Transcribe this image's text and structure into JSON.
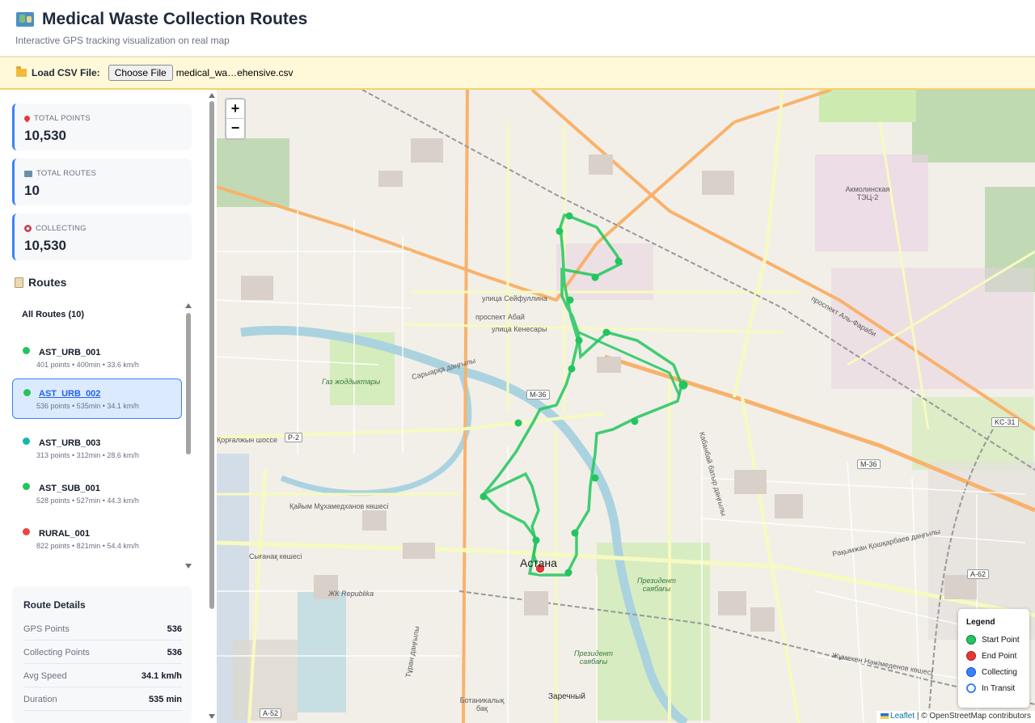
{
  "header": {
    "title": "Medical Waste Collection Routes",
    "subtitle": "Interactive GPS tracking visualization on real map"
  },
  "loader": {
    "label": "Load CSV File:",
    "button": "Choose File",
    "filename": "medical_wa…ehensive.csv"
  },
  "stats": [
    {
      "label": "TOTAL POINTS",
      "value": "10,530"
    },
    {
      "label": "TOTAL ROUTES",
      "value": "10"
    },
    {
      "label": "COLLECTING",
      "value": "10,530"
    }
  ],
  "routes": {
    "heading": "Routes",
    "all_label": "All Routes (10)",
    "items": [
      {
        "name": "AST_URB_001",
        "meta": "401 points • 400min • 33.6 km/h",
        "color": "#22c55e"
      },
      {
        "name": "AST_URB_002",
        "meta": "536 points • 535min • 34.1 km/h",
        "color": "#22c55e"
      },
      {
        "name": "AST_URB_003",
        "meta": "313 points • 312min • 28.6 km/h",
        "color": "#14b8a6"
      },
      {
        "name": "AST_SUB_001",
        "meta": "528 points • 527min • 44.3 km/h",
        "color": "#22c55e"
      },
      {
        "name": "RURAL_001",
        "meta": "822 points • 821min • 54.4 km/h",
        "color": "#ef4444"
      }
    ],
    "selected": "AST_URB_002"
  },
  "details": {
    "heading": "Route Details",
    "rows": [
      {
        "key": "GPS Points",
        "value": "536"
      },
      {
        "key": "Collecting Points",
        "value": "536"
      },
      {
        "key": "Avg Speed",
        "value": "34.1 km/h"
      },
      {
        "key": "Duration",
        "value": "535 min"
      }
    ]
  },
  "map": {
    "zoom_in": "+",
    "zoom_out": "−",
    "labels": {
      "city": "Астана",
      "tec": "Акмолинская ТЭЦ-2",
      "garden": "Ботаникалық бақ",
      "zarechny": "Заречный",
      "park1": "Президент саябағы",
      "park2": "Президент саябағы",
      "gaz": "Газ жоддыктары",
      "republika": "ЖК Republika",
      "seyfullina": "улица Сейфуллина",
      "abay": "проспект Абай",
      "kenesary": "улица Кенесары",
      "alfarabi": "проспект Аль-Фараби",
      "kabanbay": "Кабанбай батыр даңғылы",
      "koshkarbaev": "Рақымжан Қошқарбаев даңғылы",
      "syganak": "Сығанақ көшесі",
      "korgalzhyn": "Қорғалжын шоссе",
      "kayym": "Қайым Мұхамедханов көшесі",
      "turan": "Тұран даңғылы",
      "zhumeken": "Жұмекен Нәжімеденов көшесі",
      "saryarka": "Сарыарқа даңғылы"
    },
    "shields": [
      "M-36",
      "KC-31",
      "M-36",
      "A-62",
      "A-52",
      "P-2"
    ],
    "route_color": "#22c55e",
    "end_color": "#e53935"
  },
  "legend": {
    "title": "Legend",
    "items": [
      {
        "label": "Start Point",
        "color": "#22c55e"
      },
      {
        "label": "End Point",
        "color": "#e53935"
      },
      {
        "label": "Collecting",
        "color": "#3b82f6"
      },
      {
        "label": "In Transit",
        "color": "#ffffff"
      }
    ]
  },
  "attribution": {
    "leaflet": "Leaflet",
    "rest": " | © OpenStreetMap contributors"
  }
}
